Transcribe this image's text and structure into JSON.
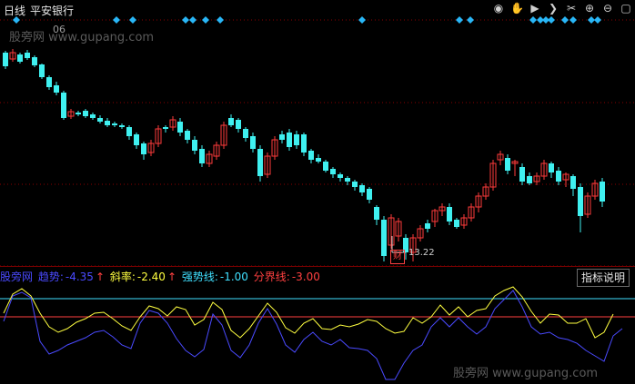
{
  "toolbar": {
    "period": "日线",
    "stock_name": "平安银行",
    "icons": [
      "eye-icon",
      "hand-icon",
      "play-icon",
      "next-icon",
      "scissors-icon",
      "zoom-in-icon",
      "zoom-out-icon",
      "maximize-icon"
    ]
  },
  "watermark": {
    "top": "股旁网 www.gupang.com",
    "bottom": "股旁网 www.gupang.com",
    "overlap_value": "06"
  },
  "price_chart": {
    "low_label": "13.22",
    "fin_marker": "财",
    "candles": [
      [
        28,
        43,
        26,
        46,
        "down"
      ],
      [
        35,
        28,
        24,
        38,
        "up"
      ],
      [
        30,
        38,
        28,
        40,
        "down"
      ],
      [
        28,
        34,
        25,
        36,
        "down"
      ],
      [
        33,
        42,
        31,
        44,
        "down"
      ],
      [
        41,
        55,
        40,
        57,
        "down"
      ],
      [
        55,
        66,
        53,
        69,
        "down"
      ],
      [
        64,
        72,
        60,
        75,
        "down"
      ],
      [
        72,
        100,
        70,
        102,
        "down"
      ],
      [
        98,
        93,
        90,
        101,
        "up"
      ],
      [
        94,
        96,
        92,
        98,
        "down"
      ],
      [
        92,
        98,
        90,
        100,
        "down"
      ],
      [
        96,
        100,
        94,
        102,
        "down"
      ],
      [
        100,
        104,
        97,
        106,
        "down"
      ],
      [
        103,
        108,
        100,
        110,
        "down"
      ],
      [
        106,
        108,
        104,
        110,
        "down"
      ],
      [
        108,
        110,
        106,
        112,
        "down"
      ],
      [
        110,
        120,
        108,
        124,
        "down"
      ],
      [
        118,
        130,
        116,
        134,
        "down"
      ],
      [
        128,
        140,
        126,
        146,
        "down"
      ],
      [
        138,
        128,
        124,
        142,
        "up"
      ],
      [
        128,
        112,
        108,
        132,
        "up"
      ],
      [
        112,
        110,
        108,
        116,
        "down"
      ],
      [
        110,
        102,
        98,
        114,
        "up"
      ],
      [
        104,
        116,
        100,
        120,
        "down"
      ],
      [
        114,
        124,
        112,
        128,
        "down"
      ],
      [
        124,
        136,
        120,
        140,
        "down"
      ],
      [
        134,
        150,
        130,
        154,
        "down"
      ],
      [
        150,
        140,
        136,
        154,
        "up"
      ],
      [
        142,
        130,
        126,
        146,
        "up"
      ],
      [
        130,
        108,
        104,
        134,
        "up"
      ],
      [
        108,
        100,
        96,
        110,
        "down"
      ],
      [
        102,
        112,
        100,
        116,
        "down"
      ],
      [
        112,
        122,
        110,
        126,
        "down"
      ],
      [
        120,
        134,
        116,
        138,
        "down"
      ],
      [
        134,
        164,
        130,
        170,
        "down"
      ],
      [
        162,
        142,
        138,
        166,
        "up"
      ],
      [
        142,
        124,
        120,
        146,
        "up"
      ],
      [
        124,
        118,
        114,
        128,
        "down"
      ],
      [
        116,
        132,
        112,
        136,
        "down"
      ],
      [
        130,
        118,
        114,
        134,
        "down"
      ],
      [
        118,
        138,
        116,
        142,
        "down"
      ],
      [
        136,
        146,
        134,
        150,
        "down"
      ],
      [
        144,
        148,
        140,
        150,
        "down"
      ],
      [
        148,
        158,
        146,
        160,
        "down"
      ],
      [
        156,
        162,
        154,
        166,
        "down"
      ],
      [
        162,
        166,
        160,
        170,
        "down"
      ],
      [
        166,
        170,
        164,
        174,
        "down"
      ],
      [
        170,
        176,
        168,
        180,
        "down"
      ],
      [
        174,
        182,
        172,
        186,
        "down"
      ],
      [
        178,
        190,
        176,
        194,
        "down"
      ],
      [
        198,
        212,
        196,
        218,
        "down"
      ],
      [
        212,
        252,
        208,
        258,
        "down"
      ],
      [
        240,
        210,
        206,
        244,
        "up"
      ],
      [
        214,
        230,
        210,
        236,
        "up"
      ],
      [
        232,
        248,
        228,
        256,
        "down"
      ],
      [
        248,
        232,
        228,
        258,
        "up"
      ],
      [
        232,
        222,
        218,
        236,
        "up"
      ],
      [
        222,
        216,
        212,
        226,
        "down"
      ],
      [
        214,
        202,
        200,
        220,
        "up"
      ],
      [
        202,
        198,
        194,
        208,
        "up"
      ],
      [
        198,
        214,
        194,
        218,
        "down"
      ],
      [
        212,
        220,
        210,
        222,
        "down"
      ],
      [
        218,
        210,
        206,
        222,
        "up"
      ],
      [
        210,
        198,
        194,
        214,
        "up"
      ],
      [
        198,
        186,
        182,
        204,
        "up"
      ],
      [
        186,
        176,
        172,
        190,
        "up"
      ],
      [
        176,
        150,
        146,
        180,
        "up"
      ],
      [
        146,
        140,
        136,
        152,
        "up"
      ],
      [
        144,
        158,
        140,
        162,
        "down"
      ],
      [
        150,
        148,
        146,
        164,
        "up"
      ],
      [
        154,
        170,
        150,
        174,
        "down"
      ],
      [
        164,
        172,
        160,
        174,
        "down"
      ],
      [
        170,
        164,
        160,
        174,
        "up"
      ],
      [
        164,
        150,
        146,
        168,
        "up"
      ],
      [
        150,
        160,
        148,
        166,
        "down"
      ],
      [
        158,
        170,
        154,
        174,
        "down"
      ],
      [
        168,
        162,
        160,
        176,
        "up"
      ],
      [
        164,
        178,
        162,
        186,
        "down"
      ],
      [
        176,
        208,
        172,
        226,
        "down"
      ],
      [
        206,
        186,
        182,
        210,
        "up"
      ],
      [
        186,
        172,
        168,
        190,
        "up"
      ],
      [
        170,
        192,
        166,
        198,
        "down"
      ]
    ]
  },
  "indicator": {
    "site": "股旁网",
    "trend_label": "趋势:",
    "trend_value": "-4.35",
    "slope_label": "斜率:",
    "slope_value": "-2.40",
    "strong_label": "强势线:",
    "strong_value": "-1.00",
    "boundary_label": "分界线:",
    "boundary_value": "-3.00",
    "help_button": "指标说明",
    "colors": {
      "trend": "#4a4aff",
      "slope": "#ffff40",
      "strong": "#40e0ff",
      "boundary": "#ff4040"
    }
  }
}
